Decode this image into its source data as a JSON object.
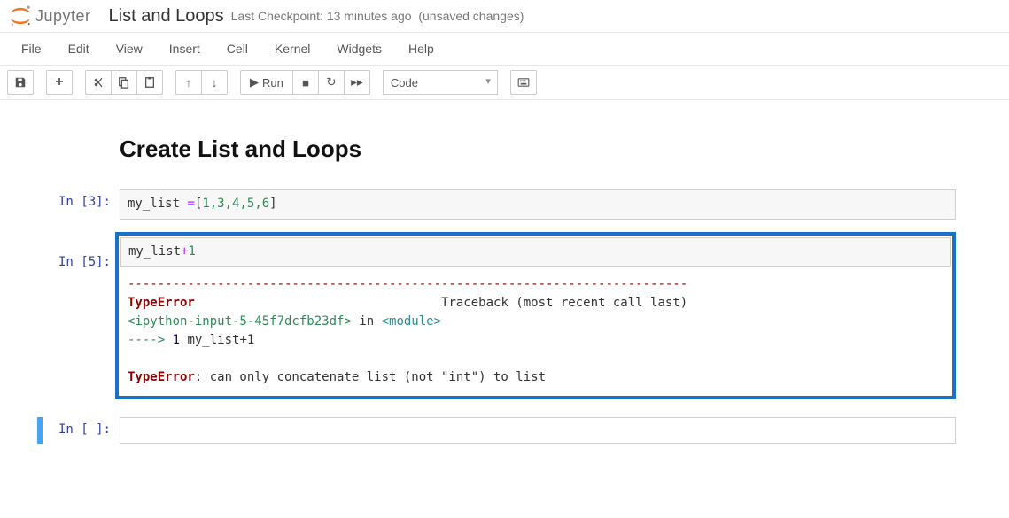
{
  "header": {
    "logo_text": "Jupyter",
    "title": "List and Loops",
    "checkpoint": "Last Checkpoint: 13 minutes ago",
    "unsaved": "(unsaved changes)"
  },
  "menubar": [
    "File",
    "Edit",
    "View",
    "Insert",
    "Cell",
    "Kernel",
    "Widgets",
    "Help"
  ],
  "toolbar": {
    "run_label": "Run",
    "cell_type": "Code"
  },
  "notebook": {
    "heading": "Create List and Loops",
    "cells": [
      {
        "prompt": "In [3]:",
        "code_plain": "my_list =[1,3,4,5,6]",
        "code_var": "my_list ",
        "code_eq": "=",
        "code_open": "[",
        "code_nums": "1,3,4,5,6",
        "code_close": "]"
      },
      {
        "prompt": "In [5]:",
        "code_var": "my_list",
        "code_op": "+",
        "code_num": "1",
        "error": {
          "dashes": "---------------------------------------------------------------------------",
          "name": "TypeError",
          "traceback_label": "Traceback (most recent call last)",
          "source": "<ipython-input-5-45f7dcfb23df>",
          "in_word": " in ",
          "module": "<module>",
          "arrow": "----> ",
          "lineno": "1",
          "line_code": " my_list+1",
          "final_name": "TypeError",
          "final_msg": ": can only concatenate list (not \"int\") to list"
        }
      },
      {
        "prompt": "In [ ]:",
        "code_plain": ""
      }
    ]
  }
}
